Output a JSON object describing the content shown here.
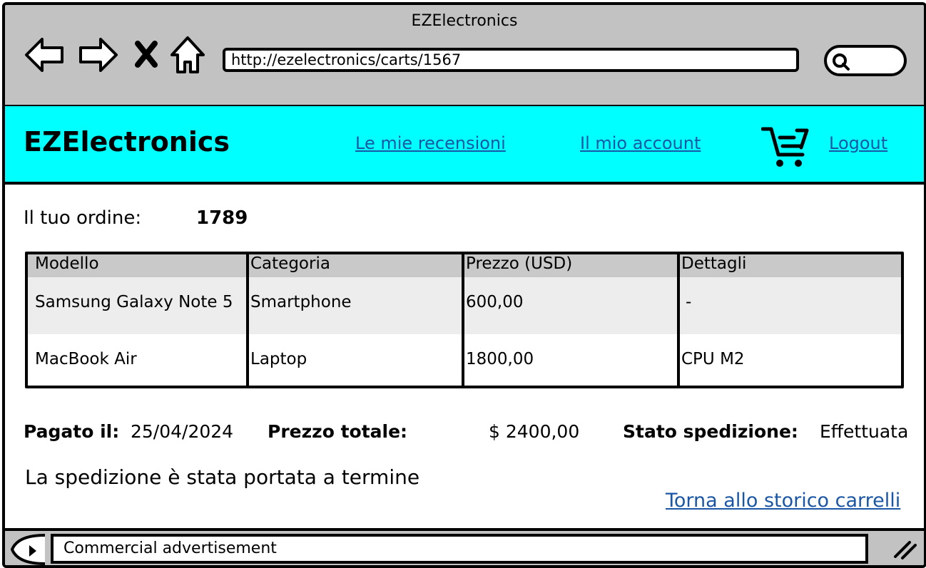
{
  "window": {
    "title": "EZElectronics"
  },
  "browser": {
    "url": "http://ezelectronics/carts/1567",
    "icons": [
      "back-arrow-icon",
      "forward-arrow-icon",
      "close-x-icon",
      "home-icon",
      "search-icon"
    ]
  },
  "header": {
    "brand": "EZElectronics",
    "links": {
      "reviews": "Le mie recensioni",
      "account": "Il mio account",
      "logout": "Logout"
    },
    "cart_icon": "shopping-cart-icon",
    "bg_color": "#00ffff"
  },
  "order": {
    "label": "Il tuo ordine:",
    "number": "1789"
  },
  "table": {
    "headers": [
      "Modello",
      "Categoria",
      "Prezzo (USD)",
      "Dettagli"
    ],
    "rows": [
      [
        "Samsung Galaxy Note 5",
        "Smartphone",
        "600,00",
        "-"
      ],
      [
        "MacBook Air",
        "Laptop",
        "1800,00",
        "CPU M2"
      ]
    ]
  },
  "summary": {
    "paid_label": "Pagato il:",
    "paid_date": "25/04/2024",
    "total_label": "Prezzo totale:",
    "total_value": "$ 2400,00",
    "status_label": "Stato spedizione:",
    "status_value": "Effettuata"
  },
  "message": "La spedizione è stata portata a termine",
  "back_link": "Torna allo storico carrelli",
  "footer": {
    "ad": "Commercial advertisement"
  }
}
